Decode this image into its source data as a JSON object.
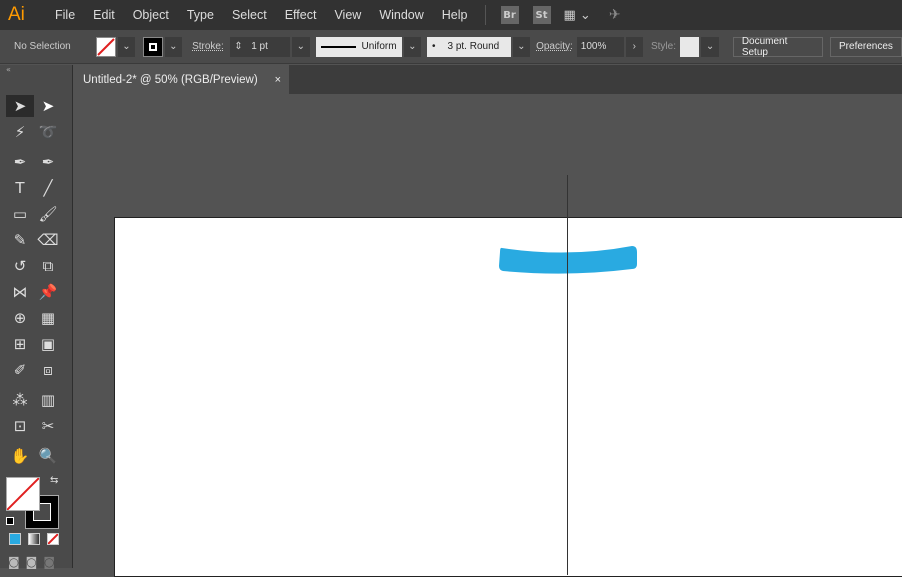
{
  "app": {
    "logo": "Ai",
    "menus": [
      "File",
      "Edit",
      "Object",
      "Type",
      "Select",
      "Effect",
      "View",
      "Window",
      "Help"
    ],
    "bridge": "Br",
    "stock": "St"
  },
  "control": {
    "selection": "No Selection",
    "stroke_label": "Stroke:",
    "stroke_weight": "1 pt",
    "profile": "Uniform",
    "brush": "3 pt. Round",
    "opacity_label": "Opacity:",
    "opacity": "100%",
    "style_label": "Style:",
    "document_setup": "Document Setup",
    "preferences": "Preferences"
  },
  "tab": {
    "title": "Untitled-2* @ 50% (RGB/Preview)",
    "close": "×"
  },
  "tools": [
    [
      "selection",
      "direct-selection"
    ],
    [
      "magic-wand",
      "lasso"
    ],
    [
      "pen",
      "curvature"
    ],
    [
      "type",
      "line-segment"
    ],
    [
      "rectangle",
      "paintbrush"
    ],
    [
      "shaper",
      "eraser"
    ],
    [
      "rotate",
      "scale"
    ],
    [
      "width",
      "puppet-warp"
    ],
    [
      "shape-builder",
      "perspective-grid"
    ],
    [
      "mesh",
      "gradient"
    ],
    [
      "eyedropper",
      "blend"
    ],
    [
      "symbol-sprayer",
      "column-graph"
    ],
    [
      "artboard",
      "slice"
    ],
    [
      "hand",
      "zoom"
    ]
  ],
  "colors": {
    "fill": "#ffffff",
    "stroke": "#000000",
    "shape": "#29aae1",
    "none_slash": "#e02020"
  }
}
